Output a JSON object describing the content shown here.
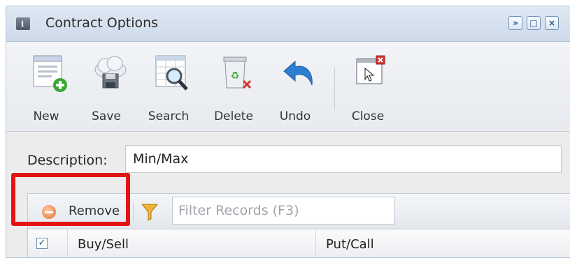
{
  "window": {
    "title": "Contract Options",
    "controls": [
      "»",
      "□",
      "×"
    ]
  },
  "toolbar": {
    "new_label": "New",
    "save_label": "Save",
    "search_label": "Search",
    "delete_label": "Delete",
    "undo_label": "Undo",
    "close_label": "Close"
  },
  "form": {
    "description_label": "Description:",
    "description_value": "Min/Max"
  },
  "grid": {
    "remove_label": "Remove",
    "filter_placeholder": "Filter Records (F3)",
    "header_checked": "✓",
    "columns": [
      "Buy/Sell",
      "Put/Call"
    ]
  },
  "colors": {
    "highlight": "#e31414",
    "titlebar": "#cfdbea",
    "accent": "#1e4e8c"
  }
}
